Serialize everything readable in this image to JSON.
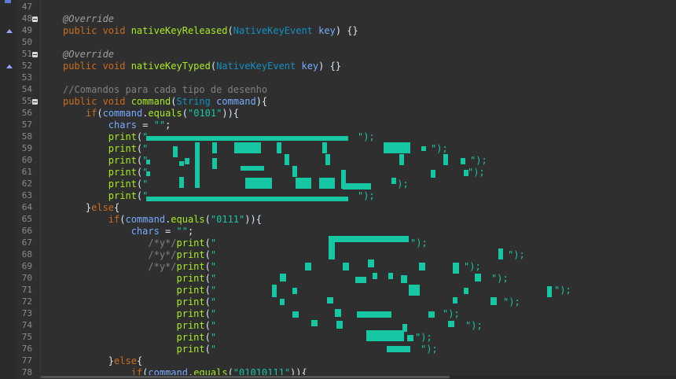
{
  "editor": {
    "lines": [
      {
        "n": "47"
      },
      {
        "n": "48",
        "fold": true,
        "tokens": [
          {
            "c": "ann",
            "t": "@Override"
          }
        ]
      },
      {
        "n": "49",
        "marker": true,
        "tokens": [
          {
            "c": "kw",
            "t": "public void "
          },
          {
            "c": "fn",
            "t": "nativeKeyReleased"
          },
          {
            "c": "p",
            "t": "("
          },
          {
            "c": "ty",
            "t": "NativeKeyEvent"
          },
          {
            "c": "p",
            "t": " "
          },
          {
            "c": "var",
            "t": "key"
          },
          {
            "c": "p",
            "t": ") {}"
          }
        ]
      },
      {
        "n": "50"
      },
      {
        "n": "51",
        "fold": true,
        "tokens": [
          {
            "c": "ann",
            "t": "@Override"
          }
        ]
      },
      {
        "n": "52",
        "marker": true,
        "tokens": [
          {
            "c": "kw",
            "t": "public void "
          },
          {
            "c": "fn",
            "t": "nativeKeyTyped"
          },
          {
            "c": "p",
            "t": "("
          },
          {
            "c": "ty",
            "t": "NativeKeyEvent"
          },
          {
            "c": "p",
            "t": " "
          },
          {
            "c": "var",
            "t": "key"
          },
          {
            "c": "p",
            "t": ") {}"
          }
        ]
      },
      {
        "n": "53"
      },
      {
        "n": "54",
        "tokens": [
          {
            "c": "cm",
            "t": "//Comandos para cada tipo de desenho"
          }
        ]
      },
      {
        "n": "55",
        "fold": true,
        "tokens": [
          {
            "c": "kw",
            "t": "public void "
          },
          {
            "c": "fn",
            "t": "command"
          },
          {
            "c": "p",
            "t": "("
          },
          {
            "c": "ty",
            "t": "String"
          },
          {
            "c": "p",
            "t": " "
          },
          {
            "c": "var",
            "t": "command"
          },
          {
            "c": "p",
            "t": "){"
          }
        ]
      },
      {
        "n": "56",
        "tokens": [
          {
            "c": "p",
            "t": "    "
          },
          {
            "c": "kw",
            "t": "if"
          },
          {
            "c": "p",
            "t": "("
          },
          {
            "c": "var",
            "t": "command"
          },
          {
            "c": "p",
            "t": "."
          },
          {
            "c": "fn",
            "t": "equals"
          },
          {
            "c": "p",
            "t": "("
          },
          {
            "c": "str",
            "t": "\"0101\""
          },
          {
            "c": "p",
            "t": ")){"
          }
        ]
      },
      {
        "n": "57",
        "tokens": [
          {
            "c": "p",
            "t": "        "
          },
          {
            "c": "var",
            "t": "chars"
          },
          {
            "c": "p",
            "t": " = "
          },
          {
            "c": "str",
            "t": "\"\""
          },
          {
            "c": "p",
            "t": ";"
          }
        ]
      },
      {
        "n": "58",
        "tokens": [
          {
            "c": "p",
            "t": "        "
          },
          {
            "c": "fn",
            "t": "print"
          },
          {
            "c": "p",
            "t": "("
          },
          {
            "c": "str",
            "t": "\""
          }
        ]
      },
      {
        "n": "59",
        "tokens": [
          {
            "c": "p",
            "t": "        "
          },
          {
            "c": "fn",
            "t": "print"
          },
          {
            "c": "p",
            "t": "("
          },
          {
            "c": "str",
            "t": "\""
          }
        ]
      },
      {
        "n": "60",
        "tokens": [
          {
            "c": "p",
            "t": "        "
          },
          {
            "c": "fn",
            "t": "print"
          },
          {
            "c": "p",
            "t": "("
          },
          {
            "c": "str",
            "t": "\""
          }
        ]
      },
      {
        "n": "61",
        "tokens": [
          {
            "c": "p",
            "t": "        "
          },
          {
            "c": "fn",
            "t": "print"
          },
          {
            "c": "p",
            "t": "("
          },
          {
            "c": "str",
            "t": "\""
          }
        ]
      },
      {
        "n": "62",
        "tokens": [
          {
            "c": "p",
            "t": "        "
          },
          {
            "c": "fn",
            "t": "print"
          },
          {
            "c": "p",
            "t": "("
          },
          {
            "c": "str",
            "t": "\""
          }
        ]
      },
      {
        "n": "63",
        "tokens": [
          {
            "c": "p",
            "t": "        "
          },
          {
            "c": "fn",
            "t": "print"
          },
          {
            "c": "p",
            "t": "("
          },
          {
            "c": "str",
            "t": "\""
          }
        ]
      },
      {
        "n": "64",
        "tokens": [
          {
            "c": "p",
            "t": "    }"
          },
          {
            "c": "kw",
            "t": "else"
          },
          {
            "c": "p",
            "t": "{"
          }
        ]
      },
      {
        "n": "65",
        "tokens": [
          {
            "c": "p",
            "t": "        "
          },
          {
            "c": "kw",
            "t": "if"
          },
          {
            "c": "p",
            "t": "("
          },
          {
            "c": "var",
            "t": "command"
          },
          {
            "c": "p",
            "t": "."
          },
          {
            "c": "fn",
            "t": "equals"
          },
          {
            "c": "p",
            "t": "("
          },
          {
            "c": "str",
            "t": "\"0111\""
          },
          {
            "c": "p",
            "t": ")){"
          }
        ]
      },
      {
        "n": "66",
        "tokens": [
          {
            "c": "p",
            "t": "            "
          },
          {
            "c": "var",
            "t": "chars"
          },
          {
            "c": "p",
            "t": " = "
          },
          {
            "c": "str",
            "t": "\"\""
          },
          {
            "c": "p",
            "t": ";"
          }
        ]
      },
      {
        "n": "67",
        "tokens": [
          {
            "c": "p",
            "t": "               "
          },
          {
            "c": "cm",
            "t": "/*y*/"
          },
          {
            "c": "fn",
            "t": "print"
          },
          {
            "c": "p",
            "t": "("
          },
          {
            "c": "str",
            "t": "\""
          }
        ]
      },
      {
        "n": "68",
        "tokens": [
          {
            "c": "p",
            "t": "               "
          },
          {
            "c": "cm",
            "t": "/*y*/"
          },
          {
            "c": "fn",
            "t": "print"
          },
          {
            "c": "p",
            "t": "("
          },
          {
            "c": "str",
            "t": "\""
          }
        ]
      },
      {
        "n": "69",
        "tokens": [
          {
            "c": "p",
            "t": "               "
          },
          {
            "c": "cm",
            "t": "/*y*/"
          },
          {
            "c": "fn",
            "t": "print"
          },
          {
            "c": "p",
            "t": "("
          },
          {
            "c": "str",
            "t": "\""
          }
        ]
      },
      {
        "n": "70",
        "tokens": [
          {
            "c": "p",
            "t": "                    "
          },
          {
            "c": "fn",
            "t": "print"
          },
          {
            "c": "p",
            "t": "("
          },
          {
            "c": "str",
            "t": "\""
          }
        ]
      },
      {
        "n": "71",
        "tokens": [
          {
            "c": "p",
            "t": "                    "
          },
          {
            "c": "fn",
            "t": "print"
          },
          {
            "c": "p",
            "t": "("
          },
          {
            "c": "str",
            "t": "\""
          }
        ]
      },
      {
        "n": "72",
        "tokens": [
          {
            "c": "p",
            "t": "                    "
          },
          {
            "c": "fn",
            "t": "print"
          },
          {
            "c": "p",
            "t": "("
          },
          {
            "c": "str",
            "t": "\""
          }
        ]
      },
      {
        "n": "73",
        "tokens": [
          {
            "c": "p",
            "t": "                    "
          },
          {
            "c": "fn",
            "t": "print"
          },
          {
            "c": "p",
            "t": "("
          },
          {
            "c": "str",
            "t": "\""
          }
        ]
      },
      {
        "n": "74",
        "tokens": [
          {
            "c": "p",
            "t": "                    "
          },
          {
            "c": "fn",
            "t": "print"
          },
          {
            "c": "p",
            "t": "("
          },
          {
            "c": "str",
            "t": "\""
          }
        ]
      },
      {
        "n": "75",
        "tokens": [
          {
            "c": "p",
            "t": "                    "
          },
          {
            "c": "fn",
            "t": "print"
          },
          {
            "c": "p",
            "t": "("
          },
          {
            "c": "str",
            "t": "\""
          }
        ]
      },
      {
        "n": "76",
        "tokens": [
          {
            "c": "p",
            "t": "                    "
          },
          {
            "c": "fn",
            "t": "print"
          },
          {
            "c": "p",
            "t": "("
          },
          {
            "c": "str",
            "t": "\""
          }
        ]
      },
      {
        "n": "77",
        "tokens": [
          {
            "c": "p",
            "t": "        }"
          },
          {
            "c": "kw",
            "t": "else"
          },
          {
            "c": "p",
            "t": "{"
          }
        ]
      },
      {
        "n": "78",
        "tokens": [
          {
            "c": "p",
            "t": "            "
          },
          {
            "c": "kw",
            "t": "if"
          },
          {
            "c": "p",
            "t": "("
          },
          {
            "c": "var",
            "t": "command"
          },
          {
            "c": "p",
            "t": "."
          },
          {
            "c": "fn",
            "t": "equals"
          },
          {
            "c": "p",
            "t": "("
          },
          {
            "c": "str",
            "t": "\"01010111\""
          },
          {
            "c": "p",
            "t": ")){"
          }
        ]
      }
    ],
    "string_endings": [
      {
        "line": "58",
        "text": "\");"
      },
      {
        "line": "59",
        "text": "\");"
      },
      {
        "line": "60",
        "text": "\");"
      },
      {
        "line": "61",
        "text": "\");"
      },
      {
        "line": "62",
        "text": "\");"
      },
      {
        "line": "63",
        "text": "\");"
      },
      {
        "line": "67",
        "text": "\");"
      },
      {
        "line": "68",
        "text": "\");"
      },
      {
        "line": "69",
        "text": "\");"
      },
      {
        "line": "70",
        "text": "\");"
      },
      {
        "line": "71",
        "text": "\");"
      },
      {
        "line": "72",
        "text": "\");"
      },
      {
        "line": "73",
        "text": "\");"
      },
      {
        "line": "74",
        "text": "\");"
      },
      {
        "line": "75",
        "text": "\");"
      },
      {
        "line": "76",
        "text": "\");"
      }
    ],
    "colors": {
      "background": "#2f2f2f",
      "keyword": "#cc6c1d",
      "method": "#a7ec21",
      "type": "#1290c3",
      "variable": "#79abff",
      "string": "#17c6a3",
      "comment": "#808080",
      "annotation": "#a0a0a0",
      "plain": "#d9e8f7"
    }
  }
}
